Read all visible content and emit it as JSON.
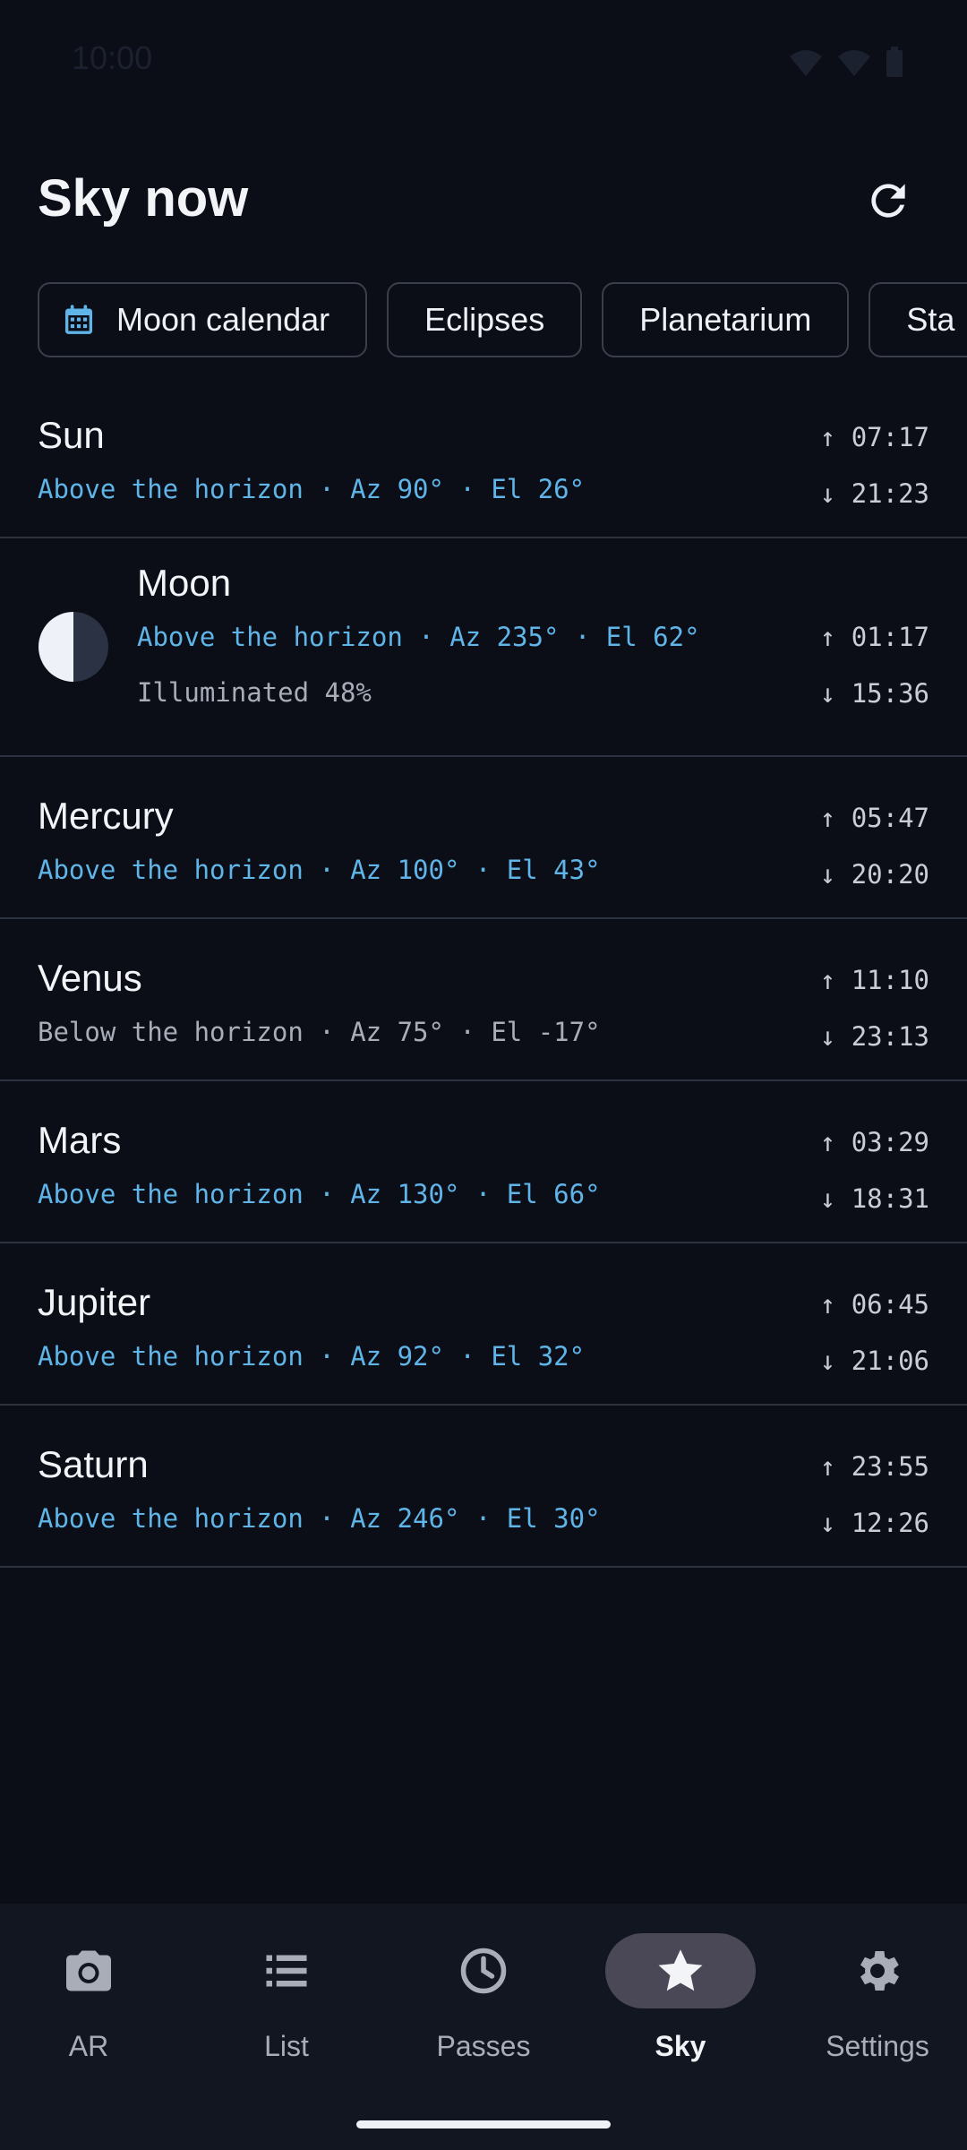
{
  "status": {
    "time": "10:00"
  },
  "header": {
    "title": "Sky now"
  },
  "chips": [
    {
      "label": "Moon calendar",
      "icon": "calendar-icon"
    },
    {
      "label": "Eclipses"
    },
    {
      "label": "Planetarium"
    },
    {
      "label": "Sta"
    }
  ],
  "objects": [
    {
      "name": "Sun",
      "position": "Above the horizon · Az 90° · El 26°",
      "rise": "↑ 07:17",
      "set": "↓ 21:23"
    },
    {
      "name": "Moon",
      "position": "Above the horizon · Az 235° · El 62°",
      "illumination": "Illuminated 48%",
      "rise": "↑ 01:17",
      "set": "↓ 15:36"
    },
    {
      "name": "Mercury",
      "position": "Above the horizon · Az 100° · El 43°",
      "rise": "↑ 05:47",
      "set": "↓ 20:20"
    },
    {
      "name": "Venus",
      "position": "Below the horizon · Az 75° · El -17°",
      "rise": "↑ 11:10",
      "set": "↓ 23:13"
    },
    {
      "name": "Mars",
      "position": "Above the horizon · Az 130° · El 66°",
      "rise": "↑ 03:29",
      "set": "↓ 18:31"
    },
    {
      "name": "Jupiter",
      "position": "Above the horizon · Az 92° · El 32°",
      "rise": "↑ 06:45",
      "set": "↓ 21:06"
    },
    {
      "name": "Saturn",
      "position": "Above the horizon · Az 246° · El 30°",
      "rise": "↑ 23:55",
      "set": "↓ 12:26"
    }
  ],
  "nav": [
    {
      "label": "AR",
      "icon": "camera-icon"
    },
    {
      "label": "List",
      "icon": "list-icon"
    },
    {
      "label": "Passes",
      "icon": "clock-icon"
    },
    {
      "label": "Sky",
      "icon": "star-icon",
      "active": true
    },
    {
      "label": "Settings",
      "icon": "gear-icon"
    }
  ],
  "colors": {
    "background": "#0b0e17",
    "accent": "#5fb4e8",
    "nav_active_pill": "#4a4757"
  }
}
